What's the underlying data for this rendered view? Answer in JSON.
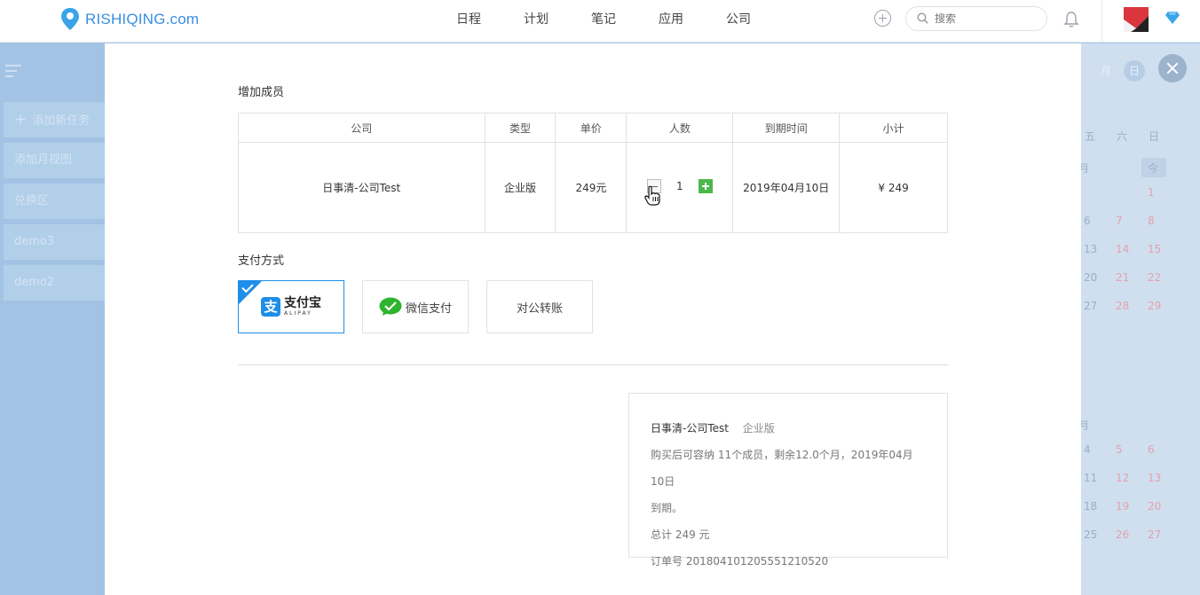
{
  "header": {
    "logo_text": "RISHIQING.com",
    "nav": [
      "日程",
      "计划",
      "笔记",
      "应用",
      "公司"
    ],
    "search_placeholder": "搜索"
  },
  "sidebar": {
    "add_task": "添加新任务",
    "items": [
      "添加月视图",
      "兑换区",
      "demo3",
      "demo2"
    ]
  },
  "calendar_bg": {
    "tabs": [
      "月",
      "日"
    ],
    "weekdays": [
      "五",
      "六",
      "日"
    ],
    "today_label": "今",
    "month_label_1": "月",
    "month_label_2": "月",
    "rows": [
      [
        "",
        "",
        "1"
      ],
      [
        "6",
        "7",
        "8"
      ],
      [
        "13",
        "14",
        "15"
      ],
      [
        "20",
        "21",
        "22"
      ],
      [
        "27",
        "28",
        "29"
      ],
      [
        "4",
        "5",
        "6"
      ],
      [
        "11",
        "12",
        "13"
      ],
      [
        "18",
        "19",
        "20"
      ],
      [
        "25",
        "26",
        "27"
      ]
    ]
  },
  "modal": {
    "add_members_title": "增加成员",
    "table": {
      "headers": [
        "公司",
        "类型",
        "单价",
        "人数",
        "到期时间",
        "小计"
      ],
      "row": {
        "company": "日事清-公司Test",
        "type": "企业版",
        "price": "249元",
        "quantity": "1",
        "expiry": "2019年04月10日",
        "subtotal": "¥ 249"
      }
    },
    "payment_title": "支付方式",
    "payment_methods": {
      "alipay_cn": "支付宝",
      "alipay_en": "ALIPAY",
      "wechat": "微信支付",
      "transfer": "对公转账"
    },
    "summary": {
      "company": "日事清-公司Test",
      "type": "企业版",
      "desc_1": "购买后可容纳 11个成员，剩余12.0个月，2019年04月10日",
      "desc_2": "到期。",
      "total": "总计 249 元",
      "order": "订单号 201804101205551210520"
    }
  },
  "colors": {
    "accent": "#1e8ee8",
    "plus_green": "#4bb84b",
    "overlay_blue": "#a7c6e6"
  }
}
